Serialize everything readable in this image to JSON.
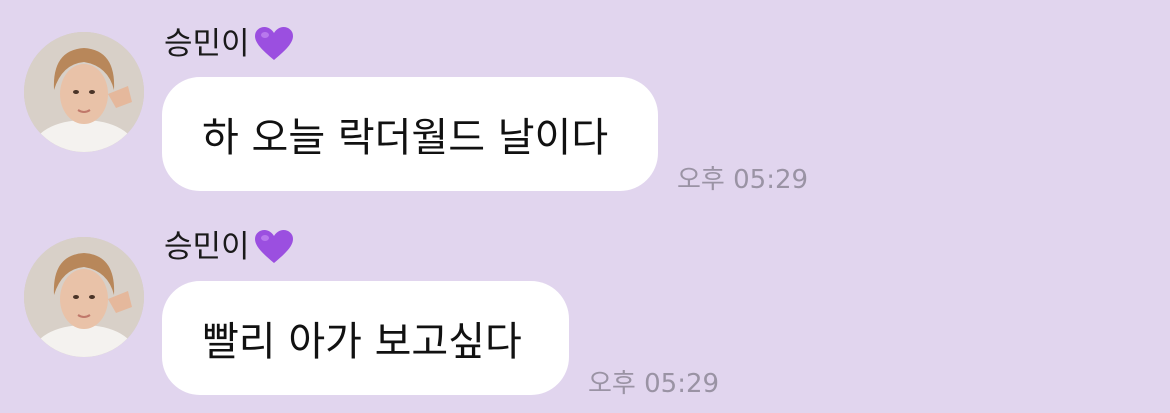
{
  "colors": {
    "background": "#e1d5ee",
    "bubble": "#ffffff",
    "heart": "#9b4fe0",
    "timestamp": "#9a93a4"
  },
  "messages": [
    {
      "sender": "승민이",
      "sender_emoji": "purple-heart-icon",
      "text": "하 오늘 락더월드 날이다",
      "time": "오후 05:29"
    },
    {
      "sender": "승민이",
      "sender_emoji": "purple-heart-icon",
      "text": "빨리 아가 보고싶다",
      "time": "오후 05:29"
    }
  ]
}
